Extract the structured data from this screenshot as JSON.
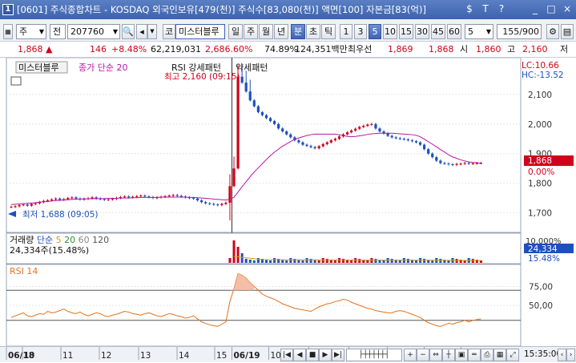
{
  "window": {
    "badge": "1",
    "title": "[0601] 주식종합차트 - KOSDAQ 외국인보유[479(천)] 주식수[83,080(천)] 액면[100] 자본금[83(억)]",
    "controls": [
      "$",
      "T",
      "?",
      "_",
      "□",
      "×"
    ]
  },
  "toolbar": {
    "type_select": "주",
    "mode_select": "전",
    "code_value": "207760",
    "market_label": "코",
    "stock_name": "미스터블루",
    "periods": [
      "일",
      "주",
      "월",
      "년",
      "분",
      "초",
      "틱"
    ],
    "active_period": "분",
    "intervals": [
      "1",
      "3",
      "5",
      "10",
      "15",
      "30",
      "45",
      "60"
    ],
    "active_interval": "5",
    "interval_input": "5",
    "count_value": "155",
    "count_total": "/900"
  },
  "infobar": {
    "price": "1,868",
    "arrow": "▲",
    "change": "146",
    "change_pct": "+8.48%",
    "volume": "62,219,031",
    "volume_pct": "2,686.60%",
    "turnover": "74.89%",
    "amount": "124,351백만",
    "bid_label": "최우선",
    "bid": "1,869",
    "ask": "1,868",
    "open_label": "시",
    "open": "1,860",
    "high_label": "고",
    "high": "2,160",
    "low_label": "저"
  },
  "chart_data": [
    {
      "type": "candlestick",
      "legend": [
        "미스터블루",
        "종가 단순 20",
        "RSI 강세패턴",
        "약세패턴"
      ],
      "ylim": [
        1650,
        2170
      ],
      "yticks": [
        1700,
        1800,
        1900,
        2000,
        2100
      ],
      "ytick_labels": [
        "1,700",
        "1,800",
        "1,900",
        "2,000",
        "2,100"
      ],
      "corner_labels": [
        "LC:10.66",
        "HC:-13.52"
      ],
      "annotations": [
        "최고 2,160 (09:15)",
        "최저 1,688 (09:05)"
      ],
      "last_price_label": "1,868",
      "last_pct_label": "0.00%",
      "close": [
        1720,
        1722,
        1726,
        1728,
        1724,
        1730,
        1732,
        1736,
        1740,
        1742,
        1745,
        1748,
        1744,
        1746,
        1750,
        1752,
        1748,
        1745,
        1747,
        1749,
        1752,
        1748,
        1746,
        1744,
        1745,
        1747,
        1750,
        1753,
        1755,
        1752,
        1754,
        1756,
        1758,
        1755,
        1753,
        1750,
        1752,
        1754,
        1756,
        1758,
        1760,
        1757,
        1755,
        1752,
        1750,
        1748,
        1742,
        1736,
        1732,
        1730,
        1728,
        1726,
        1730,
        1734,
        1790,
        1850,
        2160,
        2140,
        2110,
        2080,
        2060,
        2040,
        2030,
        2020,
        2010,
        2000,
        1985,
        1975,
        1965,
        1955,
        1945,
        1938,
        1930,
        1926,
        1922,
        1918,
        1925,
        1932,
        1938,
        1945,
        1950,
        1958,
        1965,
        1972,
        1978,
        1984,
        1990,
        1994,
        1998,
        2000,
        1985,
        1975,
        1968,
        1960,
        1955,
        1952,
        1950,
        1948,
        1945,
        1942,
        1938,
        1930,
        1915,
        1900,
        1888,
        1876,
        1868,
        1866,
        1864,
        1862,
        1865,
        1866,
        1868,
        1866,
        1867,
        1868,
        1868
      ],
      "ma20": [
        1728,
        1729,
        1730,
        1731,
        1732,
        1733,
        1734,
        1736,
        1737,
        1738,
        1740,
        1741,
        1742,
        1743,
        1744,
        1745,
        1746,
        1746,
        1747,
        1747,
        1748,
        1748,
        1748,
        1748,
        1749,
        1749,
        1749,
        1750,
        1750,
        1750,
        1751,
        1751,
        1752,
        1752,
        1752,
        1752,
        1752,
        1753,
        1753,
        1753,
        1753,
        1753,
        1753,
        1753,
        1752,
        1752,
        1751,
        1750,
        1749,
        1748,
        1746,
        1745,
        1744,
        1743,
        1746,
        1752,
        1770,
        1788,
        1805,
        1822,
        1838,
        1852,
        1866,
        1880,
        1893,
        1905,
        1915,
        1925,
        1933,
        1941,
        1948,
        1953,
        1957,
        1961,
        1964,
        1966,
        1966,
        1966,
        1966,
        1966,
        1966,
        1964,
        1961,
        1958,
        1957,
        1958,
        1960,
        1962,
        1965,
        1967,
        1968,
        1969,
        1969,
        1969,
        1969,
        1968,
        1967,
        1966,
        1965,
        1964,
        1962,
        1957,
        1949,
        1940,
        1932,
        1923,
        1914,
        1905,
        1896,
        1889,
        1884,
        1879,
        1875,
        1872,
        1870,
        1869,
        1868
      ]
    },
    {
      "type": "bar",
      "legend": [
        "거래량",
        "단순",
        "5",
        "20",
        "60",
        "120"
      ],
      "info": "24,334주(15.48%)",
      "right_labels": [
        "10,000%",
        "24,334",
        "15.48%"
      ]
    },
    {
      "type": "line",
      "legend": [
        "RSI",
        "14"
      ],
      "ylim": [
        0,
        100
      ],
      "yticks": [
        50,
        75
      ],
      "ytick_labels": [
        "50,00",
        "75,00"
      ],
      "values": [
        34,
        36,
        38,
        40,
        36,
        35,
        37,
        39,
        38,
        42,
        40,
        41,
        43,
        45,
        42,
        40,
        39,
        41,
        38,
        36,
        38,
        40,
        39,
        36,
        35,
        37,
        38,
        40,
        42,
        41,
        39,
        38,
        37,
        39,
        40,
        38,
        36,
        35,
        37,
        39,
        38,
        36,
        35,
        33,
        34,
        36,
        32,
        28,
        26,
        24,
        23,
        22,
        25,
        28,
        55,
        72,
        92,
        90,
        86,
        80,
        75,
        70,
        65,
        62,
        60,
        58,
        55,
        52,
        50,
        48,
        46,
        45,
        44,
        43,
        42,
        45,
        48,
        50,
        52,
        53,
        55,
        56,
        58,
        57,
        54,
        52,
        50,
        48,
        46,
        45,
        43,
        42,
        41,
        40,
        40,
        42,
        43,
        42,
        40,
        38,
        36,
        34,
        30,
        27,
        25,
        23,
        22,
        24,
        26,
        25,
        27,
        28,
        30,
        28,
        30,
        31,
        32
      ]
    }
  ],
  "xaxis": {
    "labels": [
      "06/18",
      "10",
      "11",
      "12",
      "13",
      "14",
      "15",
      "06/19",
      "10",
      "11",
      "12",
      "13",
      "14",
      "15"
    ],
    "time": "15:35:00"
  },
  "colors": {
    "up": "#d0021b",
    "down": "#1f4fbf",
    "ma": "#b317a8",
    "rsi": "#e4731b",
    "grid": "#e3e6ec"
  }
}
